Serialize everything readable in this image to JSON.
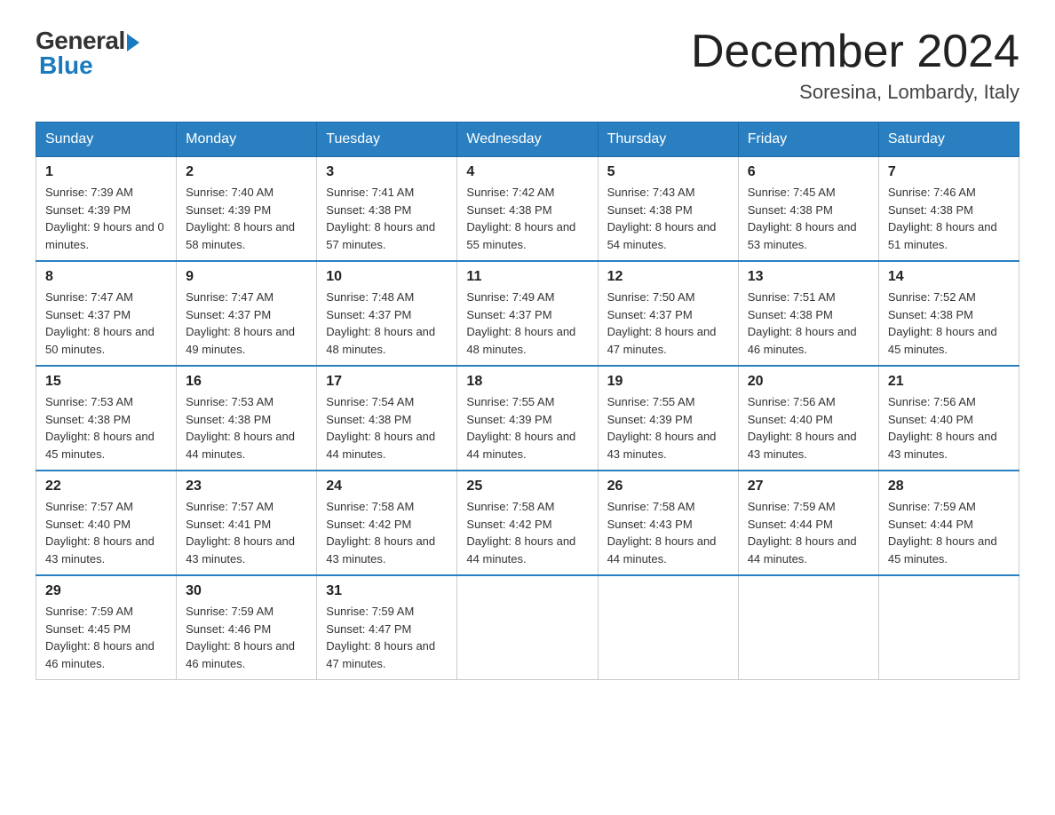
{
  "header": {
    "logo_general": "General",
    "logo_blue": "Blue",
    "month_title": "December 2024",
    "location": "Soresina, Lombardy, Italy"
  },
  "days_of_week": [
    "Sunday",
    "Monday",
    "Tuesday",
    "Wednesday",
    "Thursday",
    "Friday",
    "Saturday"
  ],
  "weeks": [
    [
      {
        "date": "1",
        "sunrise": "7:39 AM",
        "sunset": "4:39 PM",
        "daylight": "9 hours and 0 minutes."
      },
      {
        "date": "2",
        "sunrise": "7:40 AM",
        "sunset": "4:39 PM",
        "daylight": "8 hours and 58 minutes."
      },
      {
        "date": "3",
        "sunrise": "7:41 AM",
        "sunset": "4:38 PM",
        "daylight": "8 hours and 57 minutes."
      },
      {
        "date": "4",
        "sunrise": "7:42 AM",
        "sunset": "4:38 PM",
        "daylight": "8 hours and 55 minutes."
      },
      {
        "date": "5",
        "sunrise": "7:43 AM",
        "sunset": "4:38 PM",
        "daylight": "8 hours and 54 minutes."
      },
      {
        "date": "6",
        "sunrise": "7:45 AM",
        "sunset": "4:38 PM",
        "daylight": "8 hours and 53 minutes."
      },
      {
        "date": "7",
        "sunrise": "7:46 AM",
        "sunset": "4:38 PM",
        "daylight": "8 hours and 51 minutes."
      }
    ],
    [
      {
        "date": "8",
        "sunrise": "7:47 AM",
        "sunset": "4:37 PM",
        "daylight": "8 hours and 50 minutes."
      },
      {
        "date": "9",
        "sunrise": "7:47 AM",
        "sunset": "4:37 PM",
        "daylight": "8 hours and 49 minutes."
      },
      {
        "date": "10",
        "sunrise": "7:48 AM",
        "sunset": "4:37 PM",
        "daylight": "8 hours and 48 minutes."
      },
      {
        "date": "11",
        "sunrise": "7:49 AM",
        "sunset": "4:37 PM",
        "daylight": "8 hours and 48 minutes."
      },
      {
        "date": "12",
        "sunrise": "7:50 AM",
        "sunset": "4:37 PM",
        "daylight": "8 hours and 47 minutes."
      },
      {
        "date": "13",
        "sunrise": "7:51 AM",
        "sunset": "4:38 PM",
        "daylight": "8 hours and 46 minutes."
      },
      {
        "date": "14",
        "sunrise": "7:52 AM",
        "sunset": "4:38 PM",
        "daylight": "8 hours and 45 minutes."
      }
    ],
    [
      {
        "date": "15",
        "sunrise": "7:53 AM",
        "sunset": "4:38 PM",
        "daylight": "8 hours and 45 minutes."
      },
      {
        "date": "16",
        "sunrise": "7:53 AM",
        "sunset": "4:38 PM",
        "daylight": "8 hours and 44 minutes."
      },
      {
        "date": "17",
        "sunrise": "7:54 AM",
        "sunset": "4:38 PM",
        "daylight": "8 hours and 44 minutes."
      },
      {
        "date": "18",
        "sunrise": "7:55 AM",
        "sunset": "4:39 PM",
        "daylight": "8 hours and 44 minutes."
      },
      {
        "date": "19",
        "sunrise": "7:55 AM",
        "sunset": "4:39 PM",
        "daylight": "8 hours and 43 minutes."
      },
      {
        "date": "20",
        "sunrise": "7:56 AM",
        "sunset": "4:40 PM",
        "daylight": "8 hours and 43 minutes."
      },
      {
        "date": "21",
        "sunrise": "7:56 AM",
        "sunset": "4:40 PM",
        "daylight": "8 hours and 43 minutes."
      }
    ],
    [
      {
        "date": "22",
        "sunrise": "7:57 AM",
        "sunset": "4:40 PM",
        "daylight": "8 hours and 43 minutes."
      },
      {
        "date": "23",
        "sunrise": "7:57 AM",
        "sunset": "4:41 PM",
        "daylight": "8 hours and 43 minutes."
      },
      {
        "date": "24",
        "sunrise": "7:58 AM",
        "sunset": "4:42 PM",
        "daylight": "8 hours and 43 minutes."
      },
      {
        "date": "25",
        "sunrise": "7:58 AM",
        "sunset": "4:42 PM",
        "daylight": "8 hours and 44 minutes."
      },
      {
        "date": "26",
        "sunrise": "7:58 AM",
        "sunset": "4:43 PM",
        "daylight": "8 hours and 44 minutes."
      },
      {
        "date": "27",
        "sunrise": "7:59 AM",
        "sunset": "4:44 PM",
        "daylight": "8 hours and 44 minutes."
      },
      {
        "date": "28",
        "sunrise": "7:59 AM",
        "sunset": "4:44 PM",
        "daylight": "8 hours and 45 minutes."
      }
    ],
    [
      {
        "date": "29",
        "sunrise": "7:59 AM",
        "sunset": "4:45 PM",
        "daylight": "8 hours and 46 minutes."
      },
      {
        "date": "30",
        "sunrise": "7:59 AM",
        "sunset": "4:46 PM",
        "daylight": "8 hours and 46 minutes."
      },
      {
        "date": "31",
        "sunrise": "7:59 AM",
        "sunset": "4:47 PM",
        "daylight": "8 hours and 47 minutes."
      },
      null,
      null,
      null,
      null
    ]
  ]
}
